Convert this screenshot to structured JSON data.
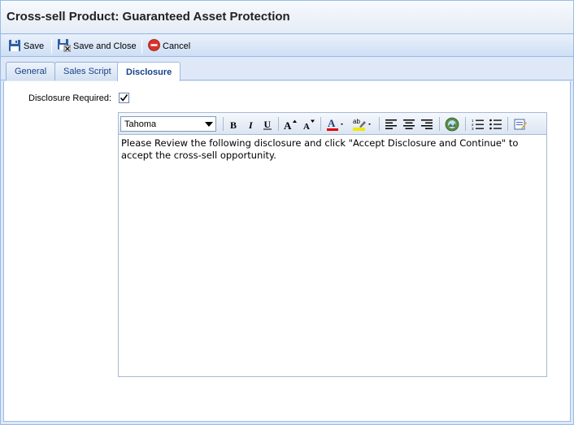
{
  "window": {
    "title": "Cross-sell Product: Guaranteed Asset Protection"
  },
  "toolbar": {
    "save_label": "Save",
    "save_close_label": "Save and Close",
    "cancel_label": "Cancel"
  },
  "tabs": [
    {
      "label": "General",
      "active": false
    },
    {
      "label": "Sales Script",
      "active": false
    },
    {
      "label": "Disclosure",
      "active": true
    }
  ],
  "disclosure": {
    "required_label": "Disclosure Required:",
    "required_checked": true
  },
  "editor": {
    "font_name": "Tahoma",
    "content": "Please Review the following disclosure and click \"Accept Disclosure and Continue\" to accept the cross-sell opportunity."
  },
  "colors": {
    "accent_border": "#99bbe8",
    "tab_text": "#15428b",
    "font_color_swatch": "#e00000",
    "highlight_swatch": "#f0e800"
  }
}
